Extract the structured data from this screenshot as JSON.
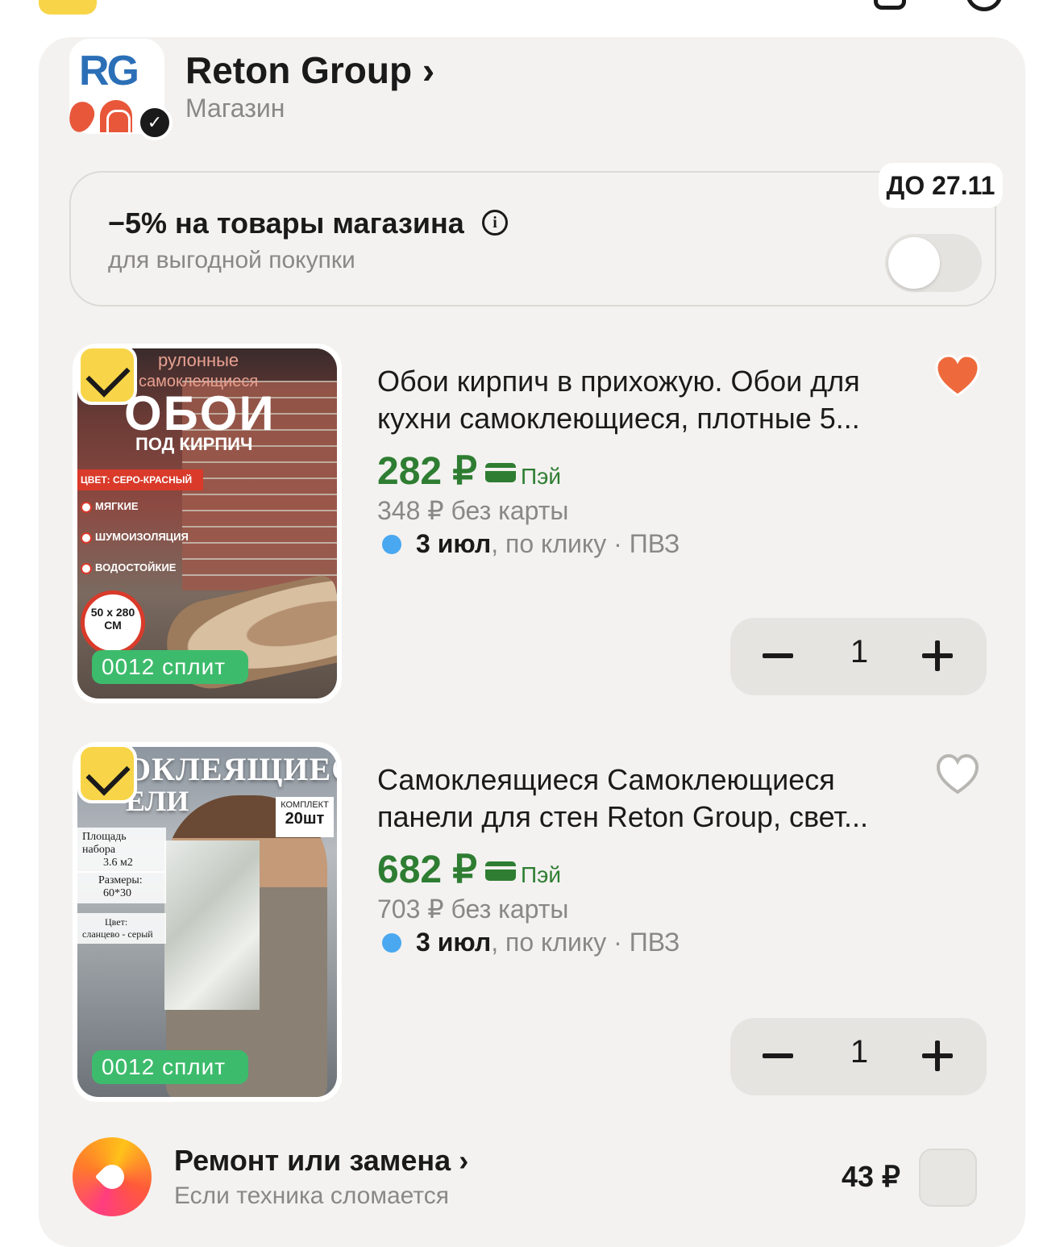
{
  "shop": {
    "logo_text": "RG",
    "name": "Reton Group",
    "chevron": "›",
    "type": "Магазин",
    "verified_icon": "verified-badge-icon"
  },
  "promo": {
    "title": "−5% на товары магазина",
    "info_icon": "i",
    "subtitle": "для выгодной покупки",
    "badge": "ДО 27.11",
    "toggle_on": false
  },
  "products": [
    {
      "image_text": {
        "line1": "рулонные",
        "line2": "самоклеящиеся",
        "big": "ОБОИ",
        "under": "ПОД КИРПИЧ",
        "color_label": "ЦВЕТ: СЕРО-КРАСНЫЙ",
        "features": [
          "МЯГКИЕ",
          "ШУМОИЗОЛЯЦИЯ",
          "ВОДОСТОЙКИЕ"
        ],
        "seal": "50 x 280 СМ"
      },
      "split": "0012 сплит",
      "selected": true,
      "title": "Обои кирпич в прихожую. Обои для кухни самоклеющиеся, плотные 5...",
      "price": "282 ₽",
      "pay": "Пэй",
      "old_price": "348 ₽  без карты",
      "delivery_date": "3 июл",
      "delivery_rest": ", по клику · ПВЗ",
      "favorite": true,
      "qty": "1"
    },
    {
      "image_text": {
        "big": "ОКЛЕЯЩИЕСЯ",
        "big2": "ЕЛИ",
        "kit_label": "КОМПЛЕКТ",
        "kit_value": "20шт",
        "spec1_label": "Площадь набора",
        "spec1_value": "3.6 м2",
        "spec2_label": "Размеры:",
        "spec2_value": "60*30",
        "spec3_label": "Цвет:",
        "spec3_value": "сланцево - серый"
      },
      "split": "0012 сплит",
      "selected": true,
      "title": "Самоклеящиеся Самоклеющиеся панели для стен Reton Group, свет...",
      "price": "682 ₽",
      "pay": "Пэй",
      "old_price": "703 ₽  без карты",
      "delivery_date": "3 июл",
      "delivery_rest": ", по клику · ПВЗ",
      "favorite": false,
      "qty": "1"
    }
  ],
  "repair": {
    "title": "Ремонт или замена",
    "chevron": "›",
    "subtitle": "Если техника сломается",
    "price": "43 ₽"
  },
  "colors": {
    "accent_yellow": "#f8d548",
    "price_green": "#2e7d32",
    "split_green": "#3dbb6c",
    "heart_orange": "#ee6a3c",
    "delivery_blue": "#4aa8f0"
  }
}
